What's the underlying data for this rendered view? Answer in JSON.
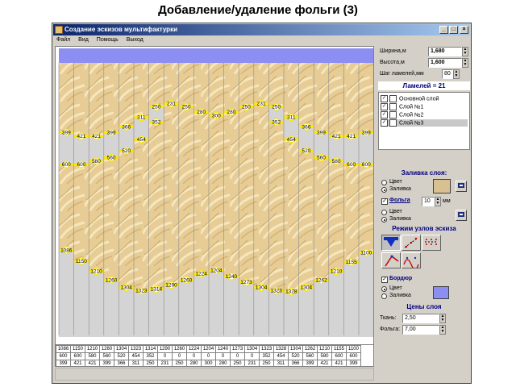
{
  "slide": {
    "title": "Добавление/удаление  фольги (3)"
  },
  "window": {
    "title": "Создание эскизов мультифактурки",
    "menu": [
      "Файл",
      "Вид",
      "Помощь",
      "Выход"
    ],
    "min_glyph": "_",
    "max_glyph": "□",
    "close_glyph": "×"
  },
  "panel": {
    "width_label": "Ширина,м",
    "width_value": "1,680",
    "height_label": "Высота,м",
    "height_value": "1,600",
    "step_label": "Шаг ламелей,мм",
    "step_value": "80",
    "lamellas_count": "Ламелей = 21",
    "layers": [
      {
        "name": "Основной слой",
        "checked": true,
        "selected": false
      },
      {
        "name": "Слой №1",
        "checked": true,
        "selected": false
      },
      {
        "name": "Слой №2",
        "checked": true,
        "selected": false
      },
      {
        "name": "Слой №3",
        "checked": true,
        "selected": true
      }
    ],
    "fill_header": "Заливка слоя:",
    "fill_color": "Цвет",
    "fill_fill": "Заливка",
    "foil_label": "Фольга",
    "foil_value": "10",
    "foil_unit": "мм",
    "foil_color": "Цвет",
    "foil_fill": "Заливка",
    "nodes_header": "Режим узлов эскиза",
    "border_label": "Бордюр",
    "border_color": "Цвет",
    "border_fill": "Заливка",
    "prices_header": "Цены слоя",
    "fabric_label": "Ткань:",
    "fabric_value": "2,50",
    "foil_price_label": "Фольга:",
    "foil_price_value": "7,00",
    "colors": {
      "fill_swatch": "#d8c090",
      "border_swatch": "#8c8ef2",
      "selected_row": "#c8c8c8"
    }
  },
  "colors": {
    "foil": "#ffe800",
    "fabric": "#e7cd95",
    "bg_area": "#d4d4d4",
    "bar": "#8c8ef2"
  },
  "sketch": {
    "lamella_numbers": [
      1,
      2,
      3,
      4,
      5,
      6,
      7,
      8,
      9,
      10,
      11,
      12,
      13,
      14,
      15,
      16,
      17,
      18,
      19,
      20,
      21
    ],
    "top_values": [
      399,
      421,
      421,
      399,
      366,
      311,
      250,
      231,
      250,
      280,
      300,
      280,
      250,
      231,
      250,
      311,
      366,
      399,
      421,
      421,
      399
    ],
    "mid_values": [
      600,
      600,
      580,
      560,
      520,
      454,
      352,
      0,
      0,
      0,
      0,
      0,
      0,
      0,
      352,
      454,
      520,
      560,
      580,
      600,
      600
    ],
    "bottom_values": [
      1086,
      1150,
      1210,
      1260,
      1304,
      1323,
      1314,
      1290,
      1260,
      1224,
      1204,
      1240,
      1273,
      1304,
      1323,
      1328,
      1304,
      1262,
      1210,
      1155,
      1100
    ]
  },
  "table": {
    "rows": [
      [
        "1086",
        "1150",
        "1210",
        "1260",
        "1304",
        "1323",
        "1314",
        "1290",
        "1260",
        "1224",
        "1204",
        "1240",
        "1273",
        "1304",
        "1323",
        "1328",
        "1304",
        "1262",
        "1210",
        "1155",
        "1100"
      ],
      [
        "600",
        "600",
        "580",
        "560",
        "520",
        "454",
        "352",
        "0",
        "0",
        "0",
        "0",
        "0",
        "0",
        "0",
        "352",
        "454",
        "520",
        "560",
        "580",
        "600",
        "600"
      ],
      [
        "399",
        "421",
        "421",
        "399",
        "366",
        "311",
        "250",
        "231",
        "250",
        "280",
        "300",
        "280",
        "250",
        "231",
        "250",
        "311",
        "366",
        "399",
        "421",
        "421",
        "399"
      ]
    ]
  }
}
